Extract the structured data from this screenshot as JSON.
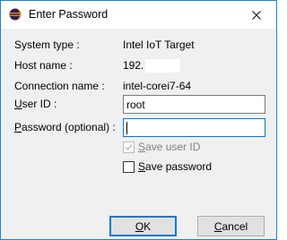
{
  "window": {
    "title": "Enter Password",
    "icon": "eclipse-icon",
    "close_icon": "close-icon"
  },
  "fields": {
    "system_type_label": "System type :",
    "system_type_value": "Intel IoT Target",
    "host_name_label": "Host name :",
    "host_name_value": "192.",
    "connection_name_label": "Connection name :",
    "connection_name_value": "intel-corei7-64",
    "user_id_label_pre": "",
    "user_id_label_mnemonic": "U",
    "user_id_label_post": "ser ID :",
    "user_id_value": "root",
    "password_label_pre": "",
    "password_label_mnemonic": "P",
    "password_label_post": "assword (optional) :",
    "password_value": ""
  },
  "checkboxes": {
    "save_user_id": {
      "mnemonic": "S",
      "rest": "ave user ID",
      "checked": true,
      "enabled": false
    },
    "save_password": {
      "pre": "",
      "mnemonic": "S",
      "rest": "ave password",
      "checked": false,
      "enabled": true
    }
  },
  "buttons": {
    "ok_mnemonic": "O",
    "ok_rest": "K",
    "cancel_mnemonic": "C",
    "cancel_rest": "ancel"
  },
  "colors": {
    "accent": "#0078d7",
    "window_border": "#1883d7",
    "dialog_bg": "#f0f0f0",
    "disabled_text": "#838383"
  }
}
